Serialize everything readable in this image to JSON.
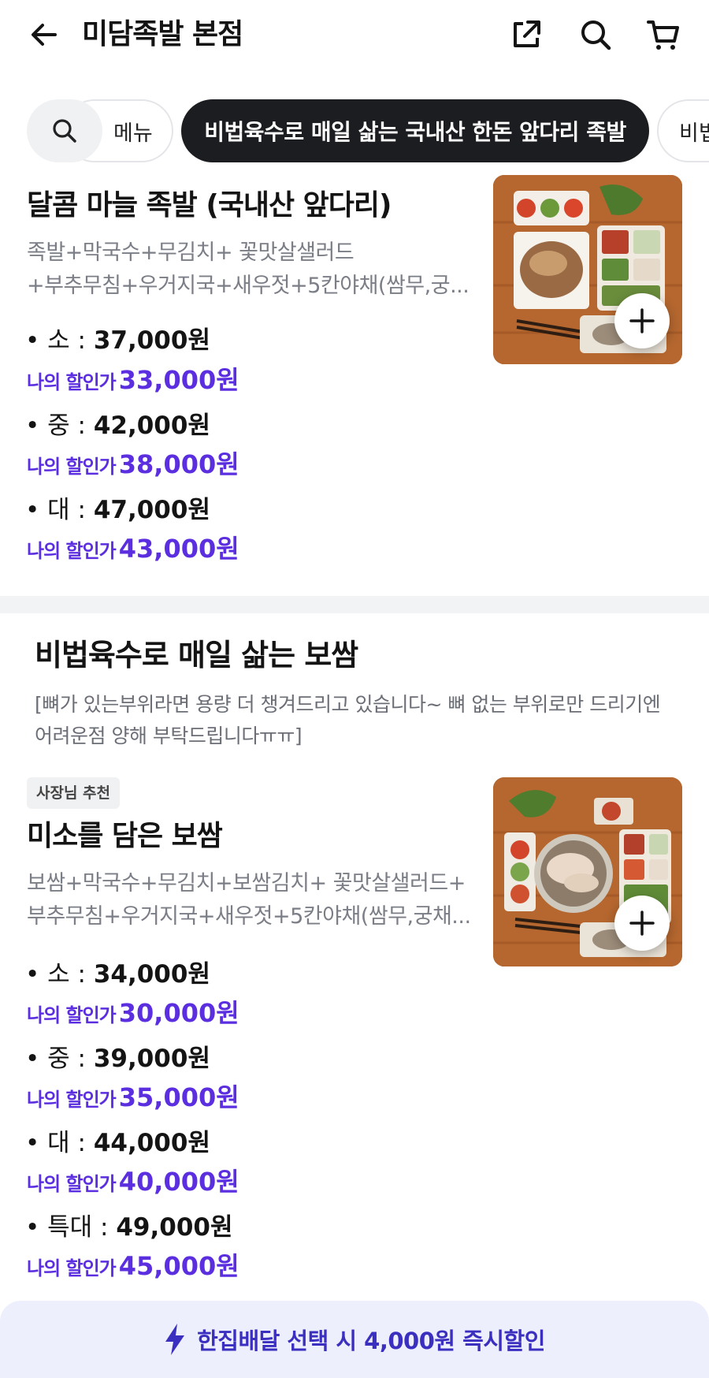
{
  "header": {
    "title": "미담족발 본점",
    "icons": [
      "back-arrow-icon",
      "share-icon",
      "search-icon",
      "cart-icon"
    ]
  },
  "categories": {
    "items": [
      "메뉴",
      "비법육수로 매일 삶는 국내산 한돈 앞다리 족발",
      "비법"
    ],
    "active_index": 1
  },
  "menu_items": [
    {
      "title": "달콤 마늘 족발 (국내산 앞다리)",
      "desc_lines": [
        "족발+막국수+무김치+ 꽃맛살샐러드",
        "+부추무침+우거지국+새우젓+5칸야채(쌈무,궁..."
      ],
      "prices": [
        {
          "label": "• 소 : ",
          "price": "37,000원",
          "disc_label": "나의 할인가",
          "disc": "33,000원"
        },
        {
          "label": "• 중 : ",
          "price": "42,000원",
          "disc_label": "나의 할인가",
          "disc": "38,000원"
        },
        {
          "label": "• 대 : ",
          "price": "47,000원",
          "disc_label": "나의 할인가",
          "disc": "43,000원"
        }
      ]
    },
    {
      "badge": "사장님 추천",
      "title": "미소를 담은 보쌈",
      "desc_lines": [
        "보쌈+막국수+무김치+보쌈김치+ 꽃맛살샐러드+",
        "부추무침+우거지국+새우젓+5칸야채(쌈무,궁채..."
      ],
      "prices": [
        {
          "label": "• 소 : ",
          "price": "34,000원",
          "disc_label": "나의 할인가",
          "disc": "30,000원"
        },
        {
          "label": "• 중 : ",
          "price": "39,000원",
          "disc_label": "나의 할인가",
          "disc": "35,000원"
        },
        {
          "label": "• 대 : ",
          "price": "44,000원",
          "disc_label": "나의 할인가",
          "disc": "40,000원"
        },
        {
          "label": "• 특대 : ",
          "price": "49,000원",
          "disc_label": "나의 할인가",
          "disc": "45,000원"
        }
      ]
    }
  ],
  "section": {
    "title": "비법육수로 매일 삶는 보쌈",
    "note": "[뼈가 있는부위라면 용량 더 챙겨드리고 있습니다~ 뼈 없는 부위로만 드리기엔 어려운점 양해 부탁드립니다ㅠㅠ]"
  },
  "bottom_bar": {
    "text": "한집배달 선택 시 4,000원 즉시할인",
    "icon": "lightning-icon"
  },
  "colors": {
    "accent_purple": "#5b2ee0",
    "chip_active_bg": "#1c1d20",
    "bottom_bar_bg": "#eeeffd",
    "bottom_bar_text": "#3b2fc0"
  }
}
